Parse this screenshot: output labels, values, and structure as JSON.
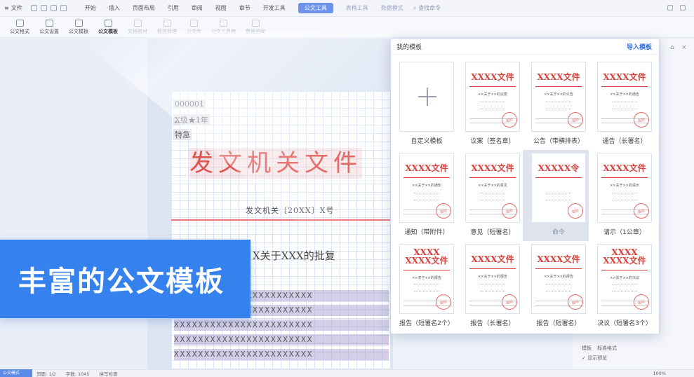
{
  "menubar": {
    "file": "文件",
    "tabs": [
      "开始",
      "插入",
      "页面布局",
      "引用",
      "审阅",
      "视图",
      "章节",
      "开发工具",
      "公文工具",
      "表格工具",
      "数据模式"
    ],
    "active_tab": "公文工具",
    "search": "查找命令"
  },
  "ribbon": {
    "items": [
      {
        "label": "公文格式",
        "state": "normal"
      },
      {
        "label": "公文设置",
        "state": "normal"
      },
      {
        "label": "公文模板",
        "state": "normal"
      },
      {
        "label": "公文模板",
        "state": "selected"
      },
      {
        "label": "文档校对",
        "state": "dim"
      },
      {
        "label": "标签管理",
        "state": "dim"
      },
      {
        "label": "公文库",
        "state": "dim"
      },
      {
        "label": "公文工具箱",
        "state": "dim"
      },
      {
        "label": "数据协同",
        "state": "dim"
      }
    ]
  },
  "document": {
    "serial": "000001",
    "secret": "X级★1年",
    "urgency": "特急",
    "title": "发文机关文件",
    "number": "发文机关〔20XX〕X号",
    "subject": "X关于XXX的批复",
    "x_rows": [
      "XXXXXXXXXXXXXXXXXXXXXXX",
      "XXXXXXXXXXXXXXXXXXXXXXX",
      "XXXXXXXXXXXXXXXXXXXXXXX",
      "XXXXXXXXXXXXXXXXXXXXXXX",
      "XXXXXXXXXXXXXXXXXXXXXXX"
    ]
  },
  "banner": {
    "text": "丰富的公文模板"
  },
  "popup": {
    "title": "我的模板",
    "import_label": "导入模板",
    "templates": [
      {
        "label": "自定义模板",
        "type": "custom"
      },
      {
        "label": "议案（签名章）",
        "header": "XXXX文件",
        "doc": "××关于××的议案"
      },
      {
        "label": "公告（带横排表）",
        "header": "XXXX文件",
        "doc": "××关于××的公告"
      },
      {
        "label": "通告（长署名）",
        "header": "XXXX文件",
        "doc": "××关于××的通告"
      },
      {
        "label": "通知（带附件）",
        "header": "XXXX文件",
        "doc": "××关于××的通知"
      },
      {
        "label": "意见（短署名）",
        "header": "XXXX文件",
        "doc": "××关于××的意见"
      },
      {
        "label": "命令",
        "header": "XXXXX令",
        "doc": "",
        "highlight": true
      },
      {
        "label": "请示（1公章）",
        "header": "XXXX文件",
        "doc": "××关于××的请示"
      },
      {
        "label": "报告（短署名2个）",
        "header": "XXXX\nXXXX文件",
        "doc": "××关于××的报告"
      },
      {
        "label": "报告（长署名）",
        "header": "XXXX文件",
        "doc": "××关于××的报告"
      },
      {
        "label": "报告（短署名）",
        "header": "XXXX文件",
        "doc": "××关于××的报告"
      },
      {
        "label": "决议（短署名3个）",
        "header": "XXXX\nXXXX文件",
        "doc": "××关于××的决议"
      }
    ],
    "seal_text": "国标"
  },
  "lower_panel": {
    "label": "模板",
    "value": "标准格式",
    "checkbox": "显示预览"
  },
  "statusbar": {
    "badge": "公文模式",
    "page": "页面: 1/2",
    "words": "字数: 1045",
    "spell": "拼写检查",
    "zoom": "100%"
  }
}
